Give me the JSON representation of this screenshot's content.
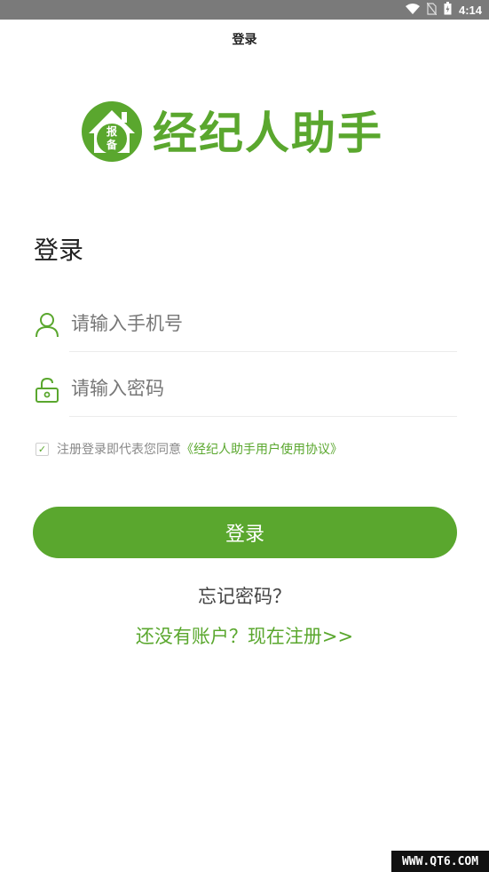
{
  "status_bar": {
    "time": "4:14",
    "icons": [
      "wifi-icon",
      "no-sim-icon",
      "battery-charging-icon"
    ]
  },
  "header": {
    "title": "登录"
  },
  "logo": {
    "badge_text": "报备",
    "app_name": "经纪人助手"
  },
  "form": {
    "heading": "登录",
    "phone": {
      "placeholder": "请输入手机号",
      "value": "",
      "icon": "user-icon"
    },
    "password": {
      "placeholder": "请输入密码",
      "value": "",
      "icon": "lock-icon"
    },
    "agreement": {
      "checked": true,
      "prefix": "注册登录即代表您同意",
      "link": "《经纪人助手用户使用协议》"
    },
    "submit_label": "登录",
    "forgot_label": "忘记密码？",
    "register_label": "还没有账户？现在注册>>"
  },
  "watermark": "WWW.QT6.COM",
  "colors": {
    "accent": "#5aa72e",
    "status_bar": "#7a7a7a"
  }
}
